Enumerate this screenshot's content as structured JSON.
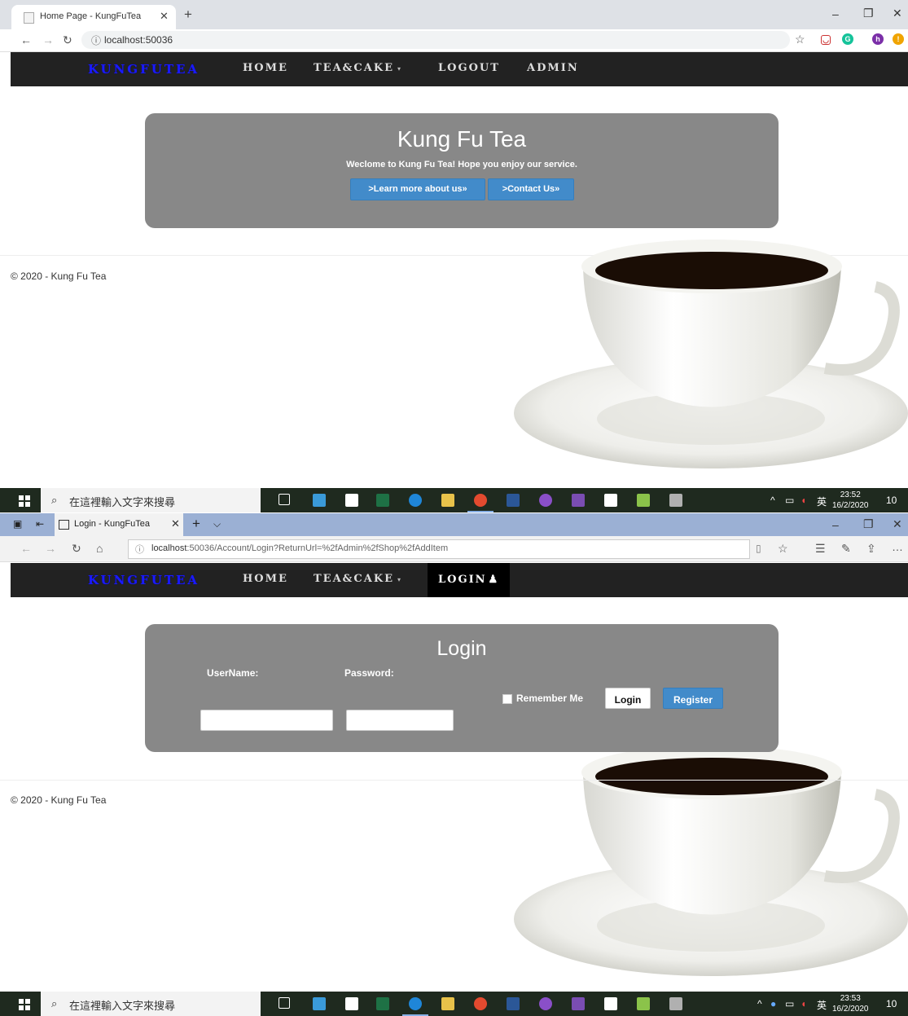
{
  "top_browser": {
    "tab_title": "Home Page - KungFuTea",
    "address": "localhost:50036"
  },
  "bottom_browser": {
    "tab_title": "Login - KungFuTea",
    "address_host": "localhost",
    "address_rest": ":50036/Account/Login?ReturnUrl=%2fAdmin%2fShop%2fAddItem"
  },
  "navbar_top": {
    "brand": "KUNGFUTEA",
    "home": "HOME",
    "teacake": "TEA&CAKE",
    "logout": "LOGOUT",
    "admin": "ADMIN"
  },
  "navbar_bottom": {
    "brand": "KUNGFUTEA",
    "home": "HOME",
    "teacake": "TEA&CAKE",
    "login": "LOGIN"
  },
  "home": {
    "title": "Kung Fu Tea",
    "lead": "Weclome to Kung Fu Tea! Hope you enjoy our service.",
    "learn_more": ">Learn more about us»",
    "contact": ">Contact Us»"
  },
  "login": {
    "title": "Login",
    "username_label": "UserName:",
    "password_label": "Password:",
    "username_value": "",
    "password_value": "",
    "remember_me": "Remember Me",
    "login_button": "Login",
    "register_button": "Register"
  },
  "footer_text": "© 2020 - Kung Fu Tea",
  "taskbar_top": {
    "search_placeholder": "在這裡輸入文字來搜尋",
    "ime": "英",
    "time": "23:52",
    "date": "16/2/2020",
    "notifications": "10"
  },
  "taskbar_bottom": {
    "search_placeholder": "在這裡輸入文字來搜尋",
    "ime": "英",
    "time": "23:53",
    "date": "16/2/2020",
    "notifications": "10"
  },
  "colors": {
    "navbar_bg": "#222222",
    "brand": "#1a1aff",
    "jumbotron_bg": "#888888",
    "button_blue": "#428bca"
  }
}
